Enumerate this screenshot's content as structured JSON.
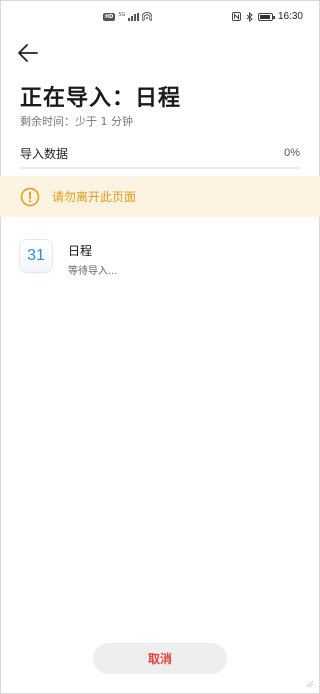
{
  "status_bar": {
    "network_badge": "HD",
    "signal_type": "5G",
    "time": "16:30",
    "icons": [
      "hd-badge-icon",
      "cellular-signal-icon",
      "hotspot-icon",
      "nfc-icon",
      "bluetooth-icon",
      "battery-icon"
    ]
  },
  "header": {
    "back_icon": "arrow-left-icon",
    "title": "正在导入：日程",
    "subtitle": "剩余时间：少于 1 分钟"
  },
  "progress": {
    "label": "导入数据",
    "value_text": "0%",
    "value": 0
  },
  "warning": {
    "icon": "exclamation-circle-icon",
    "text": "请勿离开此页面",
    "color": "#e39b14"
  },
  "import_items": [
    {
      "icon_text": "31",
      "icon": "calendar-icon",
      "name": "日程",
      "status": "等待导入..."
    }
  ],
  "footer": {
    "cancel_label": "取消",
    "cancel_color": "#e0433a"
  }
}
